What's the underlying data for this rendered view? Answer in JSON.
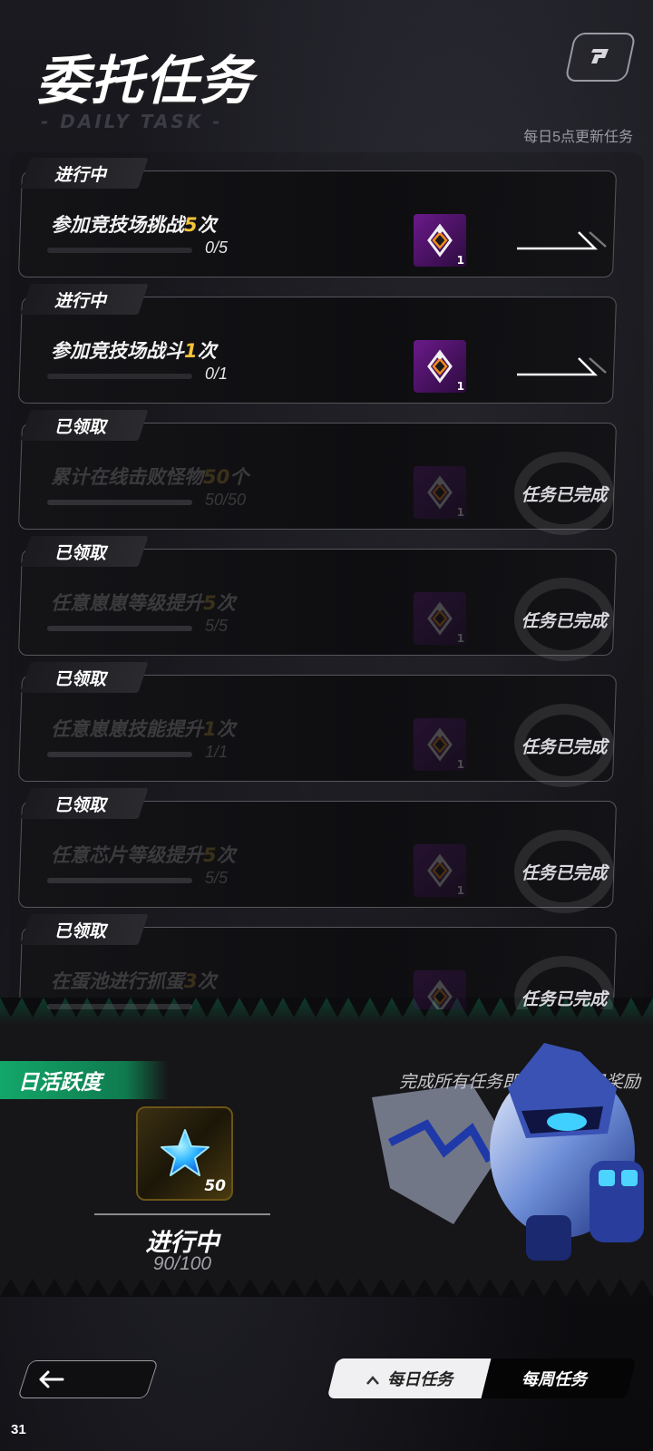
{
  "header": {
    "title": "委托任务",
    "subtitle": "- DAILY TASK -",
    "refresh_note": "每日5点更新任务"
  },
  "tasks": [
    {
      "status": "进行中",
      "name_prefix": "参加竞技场挑战",
      "name_highlight": "5",
      "name_suffix": "次",
      "progress": "0/5",
      "fraction": 0.0,
      "reward_qty": "1",
      "claimed": false
    },
    {
      "status": "进行中",
      "name_prefix": "参加竞技场战斗",
      "name_highlight": "1",
      "name_suffix": "次",
      "progress": "0/1",
      "fraction": 0.0,
      "reward_qty": "1",
      "claimed": false
    },
    {
      "status": "已领取",
      "name_prefix": "累计在线击败怪物",
      "name_highlight": "50",
      "name_suffix": "个",
      "progress": "50/50",
      "fraction": 1.0,
      "reward_qty": "1",
      "claimed": true,
      "done_label": "任务已完成"
    },
    {
      "status": "已领取",
      "name_prefix": "任意崽崽等级提升",
      "name_highlight": "5",
      "name_suffix": "次",
      "progress": "5/5",
      "fraction": 1.0,
      "reward_qty": "1",
      "claimed": true,
      "done_label": "任务已完成"
    },
    {
      "status": "已领取",
      "name_prefix": "任意崽崽技能提升",
      "name_highlight": "1",
      "name_suffix": "次",
      "progress": "1/1",
      "fraction": 1.0,
      "reward_qty": "1",
      "claimed": true,
      "done_label": "任务已完成"
    },
    {
      "status": "已领取",
      "name_prefix": "任意芯片等级提升",
      "name_highlight": "5",
      "name_suffix": "次",
      "progress": "5/5",
      "fraction": 1.0,
      "reward_qty": "1",
      "claimed": true,
      "done_label": "任务已完成"
    },
    {
      "status": "已领取",
      "name_prefix": "在蛋池进行抓蛋",
      "name_highlight": "3",
      "name_suffix": "次",
      "progress": "",
      "fraction": 1.0,
      "reward_qty": "1",
      "claimed": true,
      "done_label": "任务已完成"
    }
  ],
  "activity": {
    "label": "日活跃度",
    "hint": "完成所有任务即可解锁每日奖励",
    "reward_qty": "50",
    "status": "进行中",
    "progress": "90/100"
  },
  "tabs": {
    "daily": "每日任务",
    "weekly": "每周任务"
  },
  "page_number": "31",
  "colors": {
    "accent_green": "#13a76a",
    "highlight_yellow": "#f4c33a",
    "reward_purple": "#6a1a8a"
  }
}
